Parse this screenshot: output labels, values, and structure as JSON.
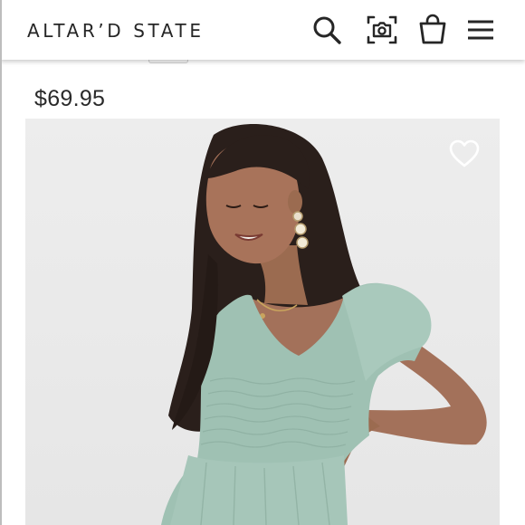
{
  "header": {
    "logo_text": "ALTAR’D STATE",
    "icons": [
      "search-icon",
      "camera-icon",
      "shopping-bag-icon",
      "hamburger-menu-icon"
    ]
  },
  "product": {
    "price": "$69.95",
    "image_alt": "Model wearing sage green smocked flutter sleeve top",
    "favorite_icon": "heart-outline-icon"
  },
  "colors": {
    "text": "#262626",
    "background": "#ffffff",
    "garment": "#9fc1b3",
    "photo_background": "#ececec"
  }
}
